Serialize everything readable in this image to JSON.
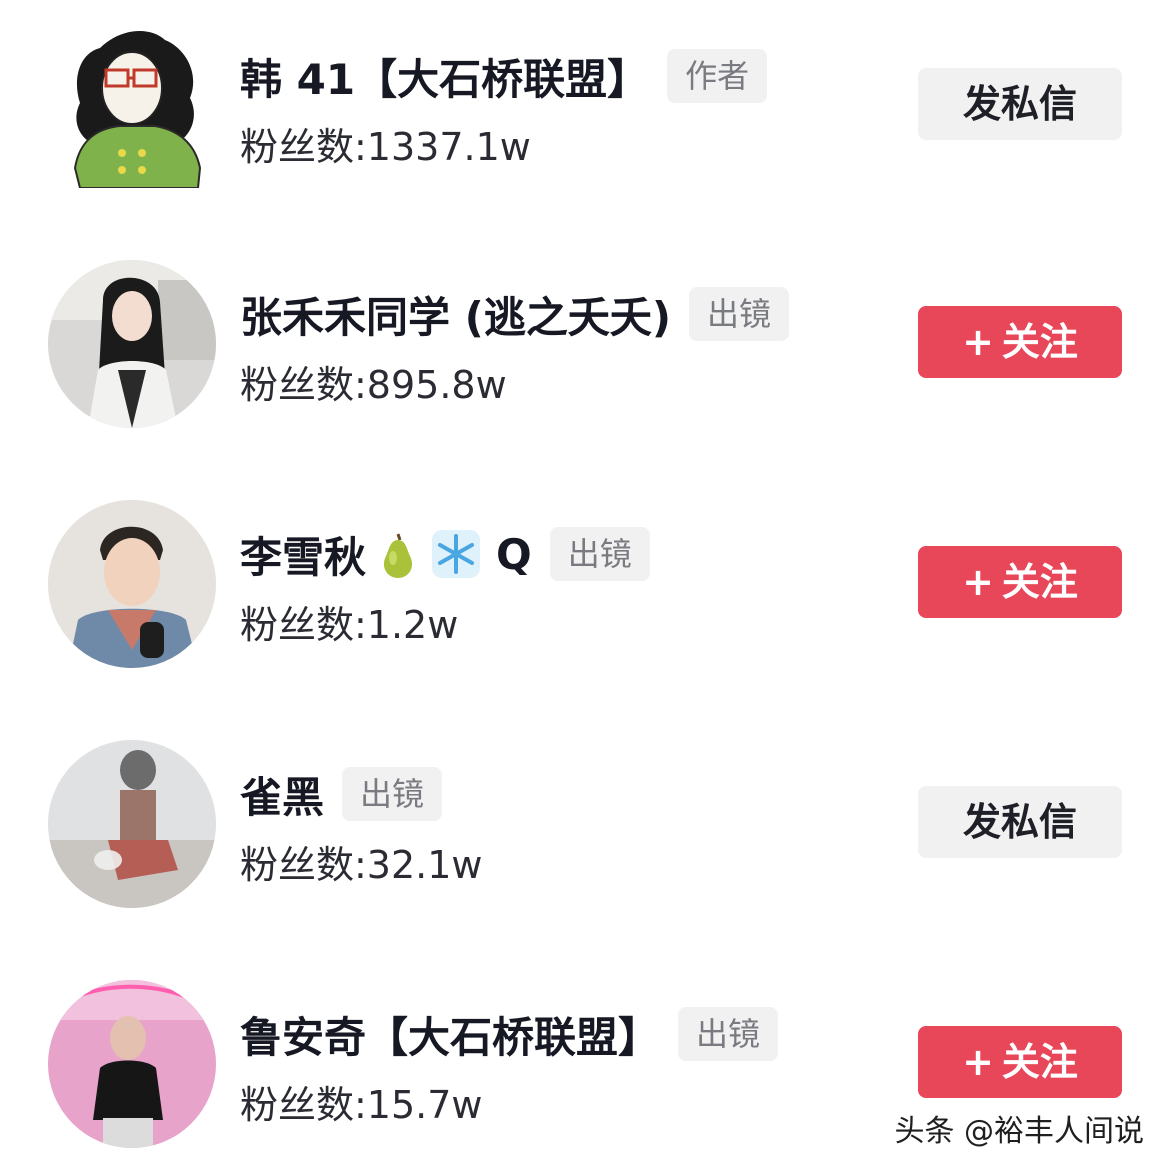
{
  "users": [
    {
      "name": "韩 41【大石桥联盟】",
      "tag": "作者",
      "fans": "粉丝数:1337.1w",
      "action": "发私信",
      "action_type": "message",
      "avatar_icon": "green-coat-cartoon-avatar"
    },
    {
      "name": "张禾禾同学 (逃之夭夭)",
      "tag": "出镜",
      "fans": "粉丝数:895.8w",
      "action": "关注",
      "action_type": "follow",
      "avatar_icon": "woman-photo-avatar"
    },
    {
      "name": "李雪秋",
      "name_emojis": [
        "pear-emoji",
        "snowflake-emoji"
      ],
      "name_suffix": "Q",
      "tag": "出镜",
      "fans": "粉丝数:1.2w",
      "action": "关注",
      "action_type": "follow",
      "avatar_icon": "young-man-microphone-avatar"
    },
    {
      "name": "雀黑",
      "tag": "出镜",
      "fans": "粉丝数:32.1w",
      "action": "发私信",
      "action_type": "message",
      "avatar_icon": "faded-child-photo-avatar"
    },
    {
      "name": "鲁安奇【大石桥联盟】",
      "tag": "出镜",
      "fans": "粉丝数:15.7w",
      "action": "关注",
      "action_type": "follow",
      "avatar_icon": "man-pink-neon-avatar"
    }
  ],
  "follow_plus": "+",
  "watermark": "头条 @裕丰人间说",
  "colors": {
    "follow_bg": "#e8475a",
    "message_bg": "#f1f1f2",
    "tag_bg": "#f1f1f2",
    "tag_text": "#7a7b80"
  }
}
